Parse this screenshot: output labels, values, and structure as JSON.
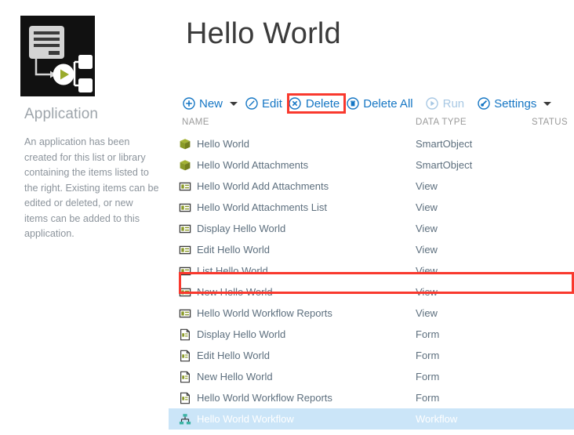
{
  "app": {
    "logo_icon": "workflow-application-logo",
    "left_heading": "Application",
    "left_description": "An application has been created for this list or library containing the items listed to the right. Existing items can be edited or deleted, or new items can be added to this application."
  },
  "header": {
    "title": "Hello World"
  },
  "toolbar": {
    "items": [
      {
        "label": "New",
        "icon": "circle-plus-icon",
        "state": "enabled",
        "has_caret": true
      },
      {
        "label": "Edit",
        "icon": "circle-pencil-icon",
        "state": "enabled",
        "has_caret": false
      },
      {
        "label": "Delete",
        "icon": "circle-x-icon",
        "state": "enabled",
        "has_caret": false,
        "highlighted": true
      },
      {
        "label": "Delete All",
        "icon": "circle-trash-icon",
        "state": "enabled",
        "has_caret": false
      },
      {
        "label": "Run",
        "icon": "circle-play-icon",
        "state": "disabled",
        "has_caret": false
      },
      {
        "label": "Settings",
        "icon": "circle-wrench-icon",
        "state": "enabled",
        "has_caret": true
      }
    ]
  },
  "list": {
    "columns": [
      "NAME",
      "DATA TYPE",
      "STATUS"
    ],
    "rows": [
      {
        "name": "Hello World",
        "data_type": "SmartObject",
        "status": "",
        "icon": "smartobject-icon",
        "selected": false
      },
      {
        "name": "Hello World Attachments",
        "data_type": "SmartObject",
        "status": "",
        "icon": "smartobject-icon",
        "selected": false
      },
      {
        "name": "Hello World Add Attachments",
        "data_type": "View",
        "status": "",
        "icon": "view-icon",
        "selected": false
      },
      {
        "name": "Hello World Attachments List",
        "data_type": "View",
        "status": "",
        "icon": "view-icon",
        "selected": false
      },
      {
        "name": "Display Hello World",
        "data_type": "View",
        "status": "",
        "icon": "view-icon",
        "selected": false
      },
      {
        "name": "Edit Hello World",
        "data_type": "View",
        "status": "",
        "icon": "view-icon",
        "selected": false
      },
      {
        "name": "List Hello World",
        "data_type": "View",
        "status": "",
        "icon": "view-icon",
        "selected": false
      },
      {
        "name": "New Hello World",
        "data_type": "View",
        "status": "",
        "icon": "view-icon",
        "selected": false
      },
      {
        "name": "Hello World Workflow Reports",
        "data_type": "View",
        "status": "",
        "icon": "view-icon",
        "selected": false
      },
      {
        "name": "Display Hello World",
        "data_type": "Form",
        "status": "",
        "icon": "form-icon",
        "selected": false
      },
      {
        "name": "Edit Hello World",
        "data_type": "Form",
        "status": "",
        "icon": "form-icon",
        "selected": false
      },
      {
        "name": "New Hello World",
        "data_type": "Form",
        "status": "",
        "icon": "form-icon",
        "selected": false
      },
      {
        "name": "Hello World Workflow Reports",
        "data_type": "Form",
        "status": "",
        "icon": "form-icon",
        "selected": false
      },
      {
        "name": "Hello World Workflow",
        "data_type": "Workflow",
        "status": "",
        "icon": "workflow-icon",
        "selected": true
      }
    ]
  },
  "colors": {
    "link_blue": "#1576c4",
    "link_blue_disabled": "#a8c8e4",
    "annotation_red": "#f9392e",
    "selection_blue": "#cbe5f8",
    "olive": "#8a9a28",
    "teal": "#3bb3a4",
    "text_gray": "#5d6f7e"
  }
}
